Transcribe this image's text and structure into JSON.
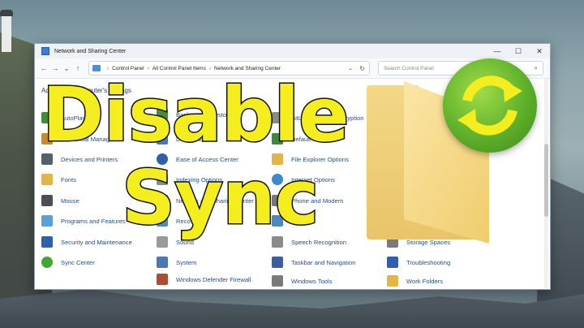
{
  "window": {
    "title": "Network and Sharing Center",
    "controls": {
      "minimize": "—",
      "maximize": "☐",
      "close": "✕"
    }
  },
  "nav": {
    "back": "←",
    "forward": "→",
    "recent": "⌄",
    "up": "↑",
    "breadcrumbs": [
      "Control Panel",
      "All Control Panel Items",
      "Network and Sharing Center"
    ],
    "refresh": "↻",
    "dropdown": "⌄"
  },
  "search": {
    "placeholder": "Search Control Panel"
  },
  "heading": "Adjust your computer's settings",
  "items": [
    {
      "label": "AutoPlay",
      "icon": "autoplay-icon",
      "color": "#3f8e3a"
    },
    {
      "label": "Credential Manager",
      "icon": "credential-manager-icon",
      "color": "#c98b2a"
    },
    {
      "label": "Devices and Printers",
      "icon": "printer-icon",
      "color": "#56606b"
    },
    {
      "label": "Fonts",
      "icon": "fonts-icon",
      "color": "#e2b544"
    },
    {
      "label": "Mouse",
      "icon": "mouse-icon",
      "color": "#4b4f55"
    },
    {
      "label": "Programs and Features",
      "icon": "programs-icon",
      "color": "#5aa0d8"
    },
    {
      "label": "Security and Maintenance",
      "icon": "flag-icon",
      "color": "#2f5fb0"
    },
    {
      "label": "Sync Center",
      "icon": "sync-icon",
      "color": "#43a534"
    },
    {
      "label": "Backup and Restore",
      "icon": "backup-icon",
      "color": "#4a8a3c"
    },
    {
      "label": "Date and Time",
      "icon": "clock-icon",
      "color": "#4a78b8"
    },
    {
      "label": "Ease of Access Center",
      "icon": "ease-of-access-icon",
      "color": "#2f5fa8"
    },
    {
      "label": "Indexing Options",
      "icon": "indexing-icon",
      "color": "#8a8a8a"
    },
    {
      "label": "Network and Sharing Center",
      "icon": "network-icon",
      "color": "#3c78c0"
    },
    {
      "label": "Recovery",
      "icon": "recovery-icon",
      "color": "#4a8ac0"
    },
    {
      "label": "Sound",
      "icon": "sound-icon",
      "color": "#9a9a9a"
    },
    {
      "label": "System",
      "icon": "system-icon",
      "color": "#4a7ab0"
    },
    {
      "label": "Windows Defender Firewall",
      "icon": "firewall-icon",
      "color": "#b04a32"
    },
    {
      "label": "BitLocker Drive Encryption",
      "icon": "bitlocker-icon",
      "color": "#8a8a8a"
    },
    {
      "label": "Default Programs",
      "icon": "default-programs-icon",
      "color": "#3c8a3a"
    },
    {
      "label": "File Explorer Options",
      "icon": "folder-options-icon",
      "color": "#e2b544"
    },
    {
      "label": "Internet Options",
      "icon": "globe-icon",
      "color": "#3a8ad0"
    },
    {
      "label": "Phone and Modem",
      "icon": "phone-icon",
      "color": "#777777"
    },
    {
      "label": "Region",
      "icon": "region-icon",
      "color": "#4a8ac0"
    },
    {
      "label": "Speech Recognition",
      "icon": "microphone-icon",
      "color": "#8a8a8a"
    },
    {
      "label": "Taskbar and Navigation",
      "icon": "taskbar-icon",
      "color": "#3a5ea0"
    },
    {
      "label": "Windows Tools",
      "icon": "tools-icon",
      "color": "#7a7a7a"
    },
    {
      "label": "Storage Spaces",
      "icon": "storage-icon",
      "color": "#7a7a7a"
    },
    {
      "label": "Troubleshooting",
      "icon": "troubleshoot-icon",
      "color": "#2f5fb0"
    },
    {
      "label": "Work Folders",
      "icon": "work-folders-icon",
      "color": "#e2b544"
    }
  ],
  "overlay": {
    "line1": "Disable",
    "line2": "Sync"
  },
  "accents": {
    "overlay_text": "#f4ee1f",
    "link_blue": "#1f4e8c",
    "sync_green": "#5fb02a",
    "folder_yellow": "#f0cc6c"
  }
}
